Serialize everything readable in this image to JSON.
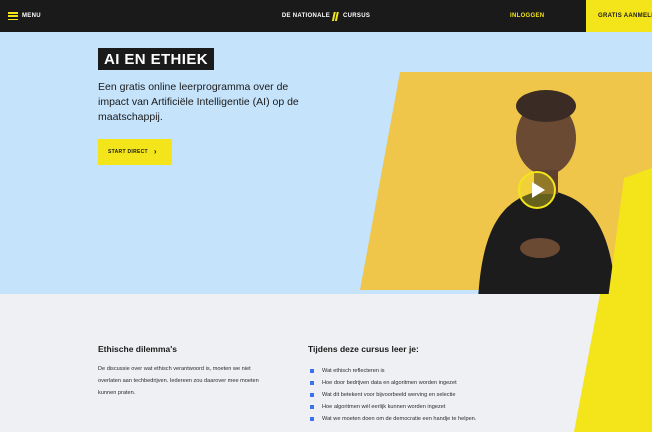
{
  "nav": {
    "menu_label": "MENU",
    "brand_label": "DE NATIONALE",
    "brand_suffix": "CURSUS",
    "login_label": "INLOGGEN",
    "signup_label": "GRATIS AANMELD"
  },
  "hero": {
    "title": "AI EN ETHIEK",
    "description": "Een gratis online leerprogramma over de impact van Artificiële Intelligentie (AI) op de maatschappij.",
    "cta_label": "START DIRECT",
    "cta_icon": "chevron-right-icon",
    "video_play_icon": "play-icon"
  },
  "dilemma": {
    "heading": "Ethische dilemma's",
    "text": "De discussie over wat ethisch verantwoord is, moeten we niet overlaten aan techbedrijven. Iedereen zou daarover mee moeten kunnen praten."
  },
  "learn": {
    "heading": "Tijdens deze cursus leer je:",
    "items": [
      "Wat ethisch reflecteren is",
      "Hoe door bedrijven data en algoritmen worden ingezet",
      "Wat dit betekent voor bijvoorbeeld werving en selectie",
      "Hoe algoritmen wél eerlijk kunnen worden ingezet",
      "Wat we moeten doen om de democratie een handje te helpen."
    ]
  },
  "colors": {
    "accent_yellow": "#f4e51a",
    "hero_background": "#c5e3fb",
    "nav_background": "#1a1a1a",
    "lower_background": "#eef0f3",
    "bullet_blue": "#3b74e8"
  }
}
